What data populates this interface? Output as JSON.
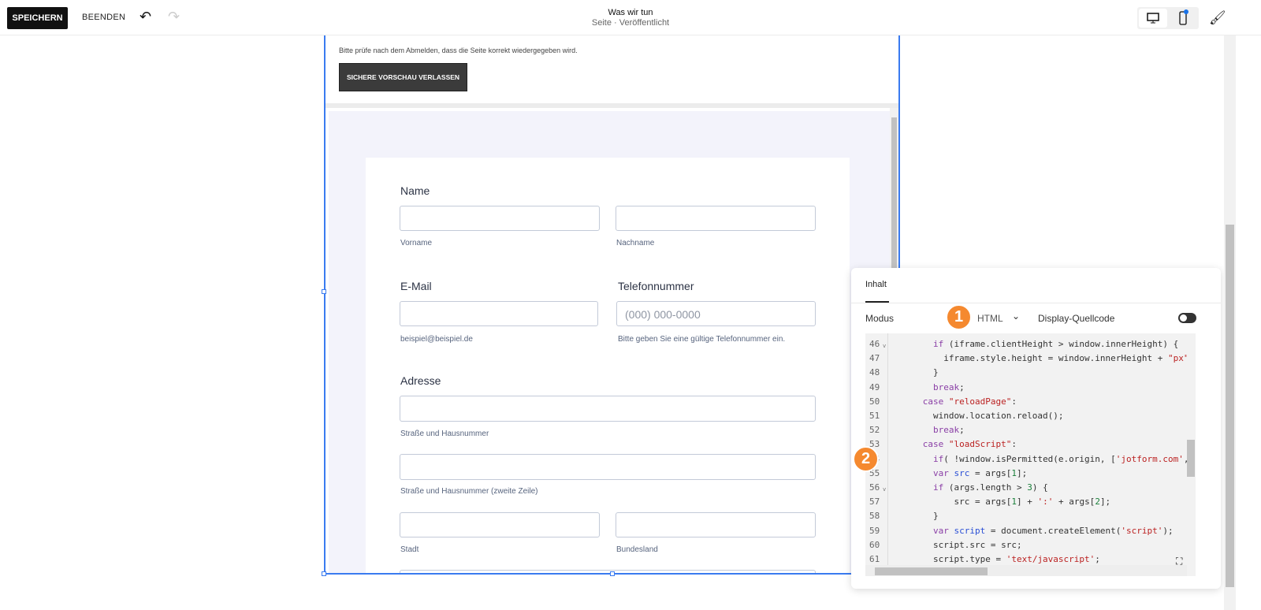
{
  "toolbar": {
    "save": "SPEICHERN",
    "exit": "BEENDEN",
    "undo_icon": "↶",
    "redo_icon": "↷",
    "title": "Was wir tun",
    "subtitle": "Seite · Veröffentlicht"
  },
  "preview": {
    "notice": "Bitte prüfe nach dem Abmelden, dass die Seite korrekt wiedergegeben wird.",
    "exit_button": "SICHERE VORSCHAU VERLASSEN"
  },
  "form": {
    "name_label": "Name",
    "first": "Vorname",
    "last": "Nachname",
    "email_label": "E-Mail",
    "email_hint": "beispiel@beispiel.de",
    "phone_label": "Telefonnummer",
    "phone_placeholder": "(000) 000-0000",
    "phone_hint": "Bitte geben Sie eine gültige Telefonnummer ein.",
    "address_label": "Adresse",
    "street": "Straße und Hausnummer",
    "street2": "Straße und Hausnummer (zweite Zeile)",
    "city": "Stadt",
    "state": "Bundesland"
  },
  "panel": {
    "tab": "Inhalt",
    "mode_label": "Modus",
    "mode_value": "HTML",
    "display_source": "Display-Quellcode",
    "display_source_on": false,
    "code": [
      {
        "n": "46",
        "fold": true,
        "html": "        <span class='kw'>if</span> (iframe.clientHeight &gt; window.innerHeight) {"
      },
      {
        "n": "47",
        "html": "          iframe.style.height = window.innerHeight + <span class='st'>\"px\"</span>"
      },
      {
        "n": "48",
        "html": "        }"
      },
      {
        "n": "49",
        "html": "        <span class='kw'>break</span>;"
      },
      {
        "n": "50",
        "html": "      <span class='kw'>case</span> <span class='st'>\"reloadPage\"</span>:"
      },
      {
        "n": "51",
        "html": "        window.location.reload();"
      },
      {
        "n": "52",
        "html": "        <span class='kw'>break</span>;"
      },
      {
        "n": "53",
        "html": "      <span class='kw'>case</span> <span class='st'>\"loadScript\"</span>:"
      },
      {
        "n": "54",
        "html": "        <span class='kw'>if</span>( !window.isPermitted(e.origin, [<span class='st'>'jotform.com'</span>,"
      },
      {
        "n": "55",
        "html": "        <span class='kw'>var</span> <span class='vr'>src</span> = args[<span class='nm'>1</span>];"
      },
      {
        "n": "56",
        "fold": true,
        "html": "        <span class='kw'>if</span> (args.length &gt; <span class='nm'>3</span>) {"
      },
      {
        "n": "57",
        "html": "            src = args[<span class='nm'>1</span>] + <span class='st'>':'</span> + args[<span class='nm'>2</span>];"
      },
      {
        "n": "58",
        "html": "        }"
      },
      {
        "n": "59",
        "html": "        <span class='kw'>var</span> <span class='vr'>script</span> = document.createElement(<span class='st'>'script'</span>);"
      },
      {
        "n": "60",
        "html": "        script.src = src;"
      },
      {
        "n": "61",
        "html": "        script.type = <span class='st'>'text/javascript'</span>;"
      }
    ]
  },
  "badges": [
    "1",
    "2"
  ],
  "colors": {
    "accent": "#3a7bf0",
    "badge": "#f5892f"
  }
}
